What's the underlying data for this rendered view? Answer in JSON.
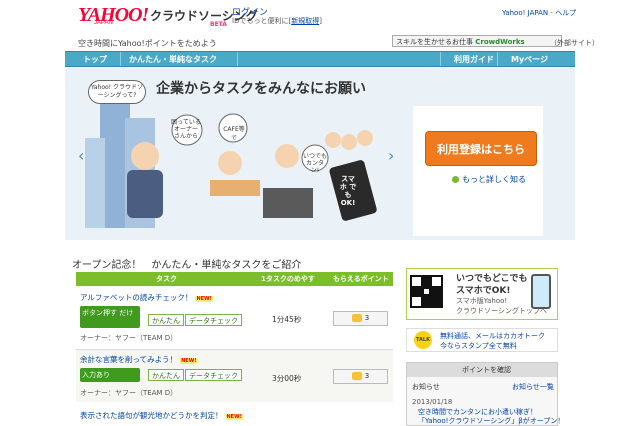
{
  "header": {
    "logo": "YAHOO!",
    "logo_sub": "JAPAN",
    "brand": "クラウドソーシング",
    "beta": "BETA",
    "login": "ログイン",
    "login_sub_prefix": "IDでもっと便利に[",
    "register": "新規取得",
    "login_sub_suffix": "]",
    "yahoo_help": "Yahoo! JAPAN - ヘルプ",
    "tagline": "空き時間にYahoo!ポイントをためよう",
    "crowd_text": "スキルを生かせるお仕事",
    "crowd_brand": "CrowdWorks",
    "external": "（外部サイト）"
  },
  "nav": {
    "top": "トップ",
    "easy": "かんたん・単純なタスク",
    "guide": "利用ガイド",
    "mypage": "Myページ"
  },
  "hero": {
    "bubble": "Yahoo! クラウドソーシングって?",
    "headline": "企業からタスクをみんなにお願い",
    "signup": "利用登録はこちら",
    "more": "もっと詳しく知る",
    "left_arrow": "‹",
    "right_arrow": "›",
    "bubble_owner": "困っている オーナー さんから",
    "bubble_cafe": "CAFE等で",
    "bubble_anytime": "いつでも カンタン!",
    "phone_text": "スマホ でも OK!"
  },
  "tasks": {
    "section_title": "オープン記念！　かんたん・単純なタスクをご紹介",
    "columns": [
      "タスク",
      "1タスクのめやす",
      "もらえるポイント"
    ],
    "rows": [
      {
        "title": "アルファベットの読みチェック！",
        "new": "NEW!",
        "button": "ボタン押す だけ",
        "tags": [
          "かんたん",
          "データチェック"
        ],
        "time": "1分45秒",
        "points": "3",
        "owner": "オーナー：ヤフー（TEAM D）"
      },
      {
        "title": "余計な言葉を削ってみよう！",
        "new": "NEW!",
        "button": "入力あり",
        "tags": [
          "かんたん",
          "データチェック"
        ],
        "time": "3分00秒",
        "points": "3",
        "owner": "オーナー：ヤフー（TEAM D）"
      },
      {
        "title": "表示された語句が観光地かどうかを判定！",
        "new": "NEW!"
      }
    ]
  },
  "side": {
    "qr_line1": "いつでもどこでも",
    "qr_line2": "スマホでOK!",
    "qr_line3": "スマホ版Yahoo!",
    "qr_line4": "クラウドソーシングトップへ",
    "talk_icon": "TALK",
    "talk_line1": "無料通話、メールはカカオトーク",
    "talk_line2": "今ならスタンプ全て無料",
    "points_check": "ポイントを確認",
    "news_tab": "お知らせ",
    "news_all": "お知らせ一覧",
    "news_date": "2013/01/18",
    "news_line1": "空き時間でカンタンにお小遣い稼ぎ！",
    "news_line2": "「Yahoo!クラウドソーシング」βがオープン！"
  }
}
